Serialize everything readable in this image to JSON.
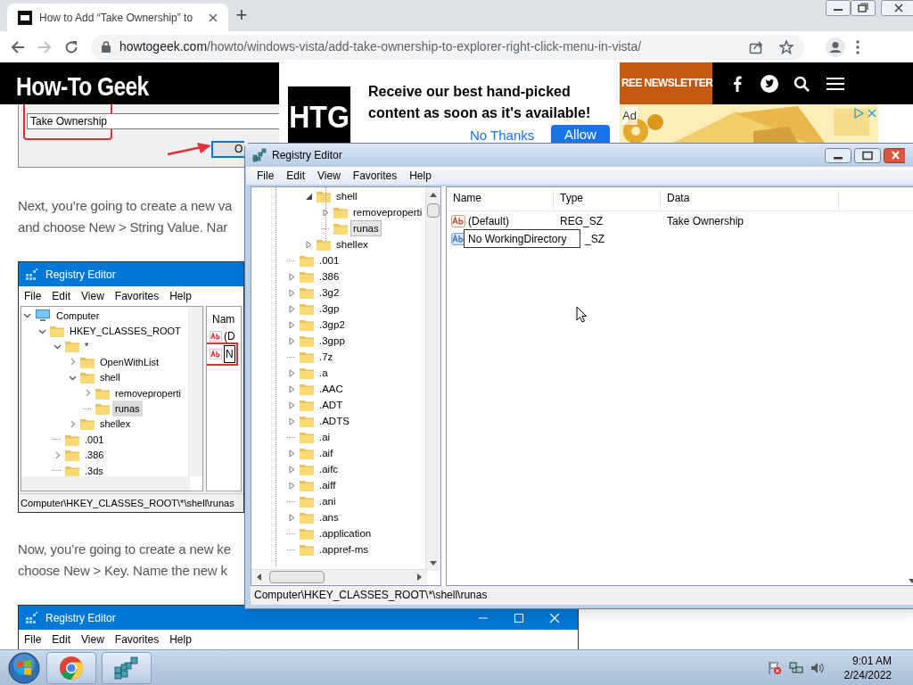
{
  "browser": {
    "tab": {
      "title": "How to Add “Take Ownership” to",
      "selected": true
    },
    "new_tab": "+",
    "url_host": "howtogeek.com",
    "url_path": "/howto/windows-vista/add-take-ownership-to-explorer-right-click-menu-in-vista/",
    "forward_disabled": true
  },
  "site_header": {
    "logo": "How-To Geek",
    "newsletter": "REE NEWSLETTER"
  },
  "notification_prompt": {
    "logo": "HTG",
    "message": "Receive our best hand-picked content as soon as it's available!",
    "buttons": [
      "No Thanks",
      "Allow"
    ]
  },
  "ad": {
    "label": "Ad"
  },
  "article": {
    "dialog_snippet": {
      "value": "Take Ownership",
      "button": "O"
    },
    "paragraphs": [
      [
        "Next, you’re going to create a new va",
        "and choose New > String Value. Nar"
      ],
      [
        "Now, you’re going to create a new ke",
        "choose New > Key. Name the new k"
      ]
    ],
    "screenshot_1": {
      "title": "Registry Editor",
      "menu": [
        "File",
        "Edit",
        "View",
        "Favorites",
        "Help"
      ],
      "tree": [
        {
          "label": "Computer",
          "kind": "computer",
          "expandable": true,
          "expanded": true,
          "selected": false,
          "children": [
            {
              "label": "HKEY_CLASSES_ROOT",
              "kind": "folder",
              "expandable": true,
              "expanded": true,
              "selected": false,
              "children": [
                {
                  "label": "*",
                  "kind": "folder",
                  "expandable": true,
                  "expanded": true,
                  "selected": false,
                  "children": [
                    {
                      "label": "OpenWithList",
                      "kind": "folder",
                      "expandable": true,
                      "expanded": false,
                      "selected": false
                    },
                    {
                      "label": "shell",
                      "kind": "folder",
                      "expandable": true,
                      "expanded": true,
                      "selected": false,
                      "children": [
                        {
                          "label": "removeproperti",
                          "kind": "folder",
                          "expandable": true,
                          "expanded": false,
                          "selected": false
                        },
                        {
                          "label": "runas",
                          "kind": "folder",
                          "expandable": false,
                          "selected": true
                        }
                      ]
                    },
                    {
                      "label": "shellex",
                      "kind": "folder",
                      "expandable": true,
                      "expanded": false,
                      "selected": false
                    }
                  ]
                },
                {
                  "label": ".001",
                  "kind": "folder",
                  "expandable": false,
                  "selected": false
                },
                {
                  "label": ".386",
                  "kind": "folder",
                  "expandable": true,
                  "expanded": false,
                  "selected": false
                },
                {
                  "label": ".3ds",
                  "kind": "folder",
                  "expandable": false,
                  "selected": false
                }
              ]
            }
          ]
        }
      ],
      "column": "Nam",
      "rows": [
        "(D",
        "N"
      ],
      "status": "Computer\\HKEY_CLASSES_ROOT\\*\\shell\\runas"
    },
    "screenshot_2": {
      "title": "Registry Editor",
      "menu": [
        "File",
        "Edit",
        "View",
        "Favorites",
        "Help"
      ]
    }
  },
  "registry_editor": {
    "title": "Registry Editor",
    "menu": [
      "File",
      "Edit",
      "View",
      "Favorites",
      "Help"
    ],
    "tree": [
      {
        "children": [
          {
            "label": "shell",
            "kind": "folder",
            "expandable": true,
            "expanded": true,
            "selected": false,
            "children": [
              {
                "label": "removeproperti",
                "kind": "folder",
                "expandable": true,
                "expanded": false,
                "selected": false
              },
              {
                "label": "runas",
                "kind": "folder",
                "expandable": false,
                "selected": true
              }
            ]
          },
          {
            "label": "shellex",
            "kind": "folder",
            "expandable": true,
            "expanded": false,
            "selected": false
          }
        ]
      },
      {
        "label": ".001",
        "kind": "folder",
        "expandable": false,
        "selected": false
      },
      {
        "label": ".386",
        "kind": "folder",
        "expandable": true,
        "expanded": false,
        "selected": false
      },
      {
        "label": ".3g2",
        "kind": "folder",
        "expandable": true,
        "expanded": false,
        "selected": false
      },
      {
        "label": ".3gp",
        "kind": "folder",
        "expandable": true,
        "expanded": false,
        "selected": false
      },
      {
        "label": ".3gp2",
        "kind": "folder",
        "expandable": true,
        "expanded": false,
        "selected": false
      },
      {
        "label": ".3gpp",
        "kind": "folder",
        "expandable": true,
        "expanded": false,
        "selected": false
      },
      {
        "label": ".7z",
        "kind": "folder",
        "expandable": false,
        "selected": false
      },
      {
        "label": ".a",
        "kind": "folder",
        "expandable": true,
        "expanded": false,
        "selected": false
      },
      {
        "label": ".AAC",
        "kind": "folder",
        "expandable": true,
        "expanded": false,
        "selected": false
      },
      {
        "label": ".ADT",
        "kind": "folder",
        "expandable": true,
        "expanded": false,
        "selected": false
      },
      {
        "label": ".ADTS",
        "kind": "folder",
        "expandable": true,
        "expanded": false,
        "selected": false
      },
      {
        "label": ".ai",
        "kind": "folder",
        "expandable": false,
        "selected": false
      },
      {
        "label": ".aif",
        "kind": "folder",
        "expandable": true,
        "expanded": false,
        "selected": false
      },
      {
        "label": ".aifc",
        "kind": "folder",
        "expandable": true,
        "expanded": false,
        "selected": false
      },
      {
        "label": ".aiff",
        "kind": "folder",
        "expandable": true,
        "expanded": false,
        "selected": false
      },
      {
        "label": ".ani",
        "kind": "folder",
        "expandable": false,
        "selected": false
      },
      {
        "label": ".ans",
        "kind": "folder",
        "expandable": true,
        "expanded": false,
        "selected": false
      },
      {
        "label": ".application",
        "kind": "folder",
        "expandable": false,
        "selected": false
      },
      {
        "label": ".appref-ms",
        "kind": "folder",
        "expandable": false,
        "selected": false
      }
    ],
    "columns": [
      "Name",
      "Type",
      "Data"
    ],
    "rows": [
      {
        "name": "(Default)",
        "type": "REG_SZ",
        "data": "Take Ownership",
        "editing": false
      },
      {
        "name": "No WorkingDirectory",
        "type": "_SZ",
        "editing": true
      }
    ],
    "status": "Computer\\HKEY_CLASSES_ROOT\\*\\shell\\runas"
  },
  "taskbar": {
    "apps": [
      {
        "kind": "chrome"
      },
      {
        "kind": "regedit"
      }
    ],
    "time": "9:01 AM",
    "date": "2/24/2022"
  }
}
